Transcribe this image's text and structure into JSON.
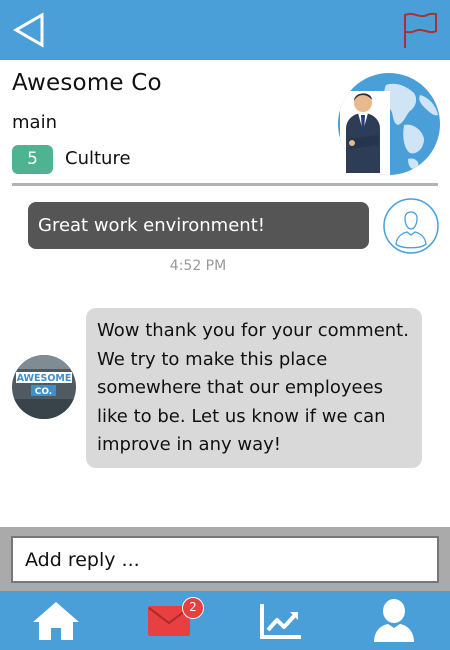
{
  "header": {
    "back_icon": "back-triangle-icon",
    "flag_icon": "flag-icon",
    "flag_color": "#b03a3a"
  },
  "company": {
    "name": "Awesome Co",
    "channel": "main",
    "count": "5",
    "category": "Culture",
    "hero_image": "businessman-world-map-illustration"
  },
  "messages": [
    {
      "from": "user",
      "text": "Great work environment!",
      "avatar": "user-outline-icon"
    },
    {
      "from": "company",
      "text": "Wow thank you for your comment. We try to make this place somewhere that our employees like to be. Let us know if we can improve in any way!",
      "avatar_logo_lines": [
        "AWESOME",
        "CO."
      ]
    }
  ],
  "timestamp": "4:52 PM",
  "reply": {
    "placeholder": "Add reply ..."
  },
  "nav": {
    "items": [
      "home-icon",
      "mail-icon",
      "analytics-icon",
      "profile-icon"
    ],
    "mail_badge": "2"
  },
  "colors": {
    "primary": "#4a9fd8",
    "badge_green": "#4fb391",
    "notification_red": "#e84040",
    "user_bubble": "#555555",
    "company_bubble": "#d9d9d9"
  }
}
